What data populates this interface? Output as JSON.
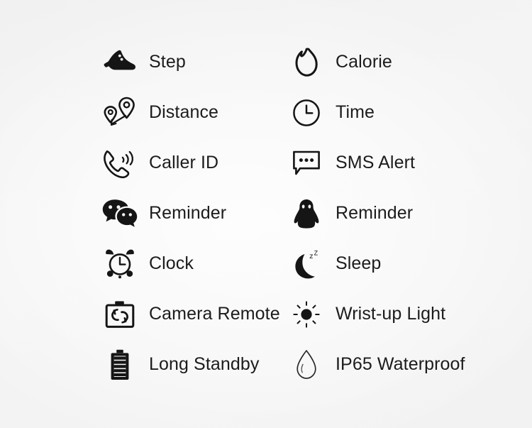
{
  "page": {
    "background_color": "#f3f3f3",
    "text_color": "#1c1c1c",
    "icon_color": "#151515"
  },
  "features": {
    "columns": 2,
    "rows": 7,
    "items": [
      {
        "label": "Step",
        "icon": "shoe-icon",
        "column": "left",
        "row": 1
      },
      {
        "label": "Calorie",
        "icon": "flame-icon",
        "column": "right",
        "row": 1
      },
      {
        "label": "Distance",
        "icon": "map-pins-icon",
        "column": "left",
        "row": 2
      },
      {
        "label": "Time",
        "icon": "clock-face-icon",
        "column": "right",
        "row": 2
      },
      {
        "label": "Caller ID",
        "icon": "phone-ringing-icon",
        "column": "left",
        "row": 3
      },
      {
        "label": "SMS Alert",
        "icon": "message-bubble-icon",
        "column": "right",
        "row": 3
      },
      {
        "label": "Reminder",
        "icon": "wechat-icon",
        "column": "left",
        "row": 4
      },
      {
        "label": "Reminder",
        "icon": "qq-penguin-icon",
        "column": "right",
        "row": 4
      },
      {
        "label": "Clock",
        "icon": "alarm-clock-icon",
        "column": "left",
        "row": 5
      },
      {
        "label": "Sleep",
        "icon": "moon-zzz-icon",
        "column": "right",
        "row": 5
      },
      {
        "label": "Camera Remote",
        "icon": "camera-rotate-icon",
        "column": "left",
        "row": 6
      },
      {
        "label": "Wrist-up Light",
        "icon": "sun-icon",
        "column": "right",
        "row": 6
      },
      {
        "label": "Long Standby",
        "icon": "battery-icon",
        "column": "left",
        "row": 7
      },
      {
        "label": "IP65 Waterproof",
        "icon": "water-drop-icon",
        "column": "right",
        "row": 7
      }
    ]
  }
}
